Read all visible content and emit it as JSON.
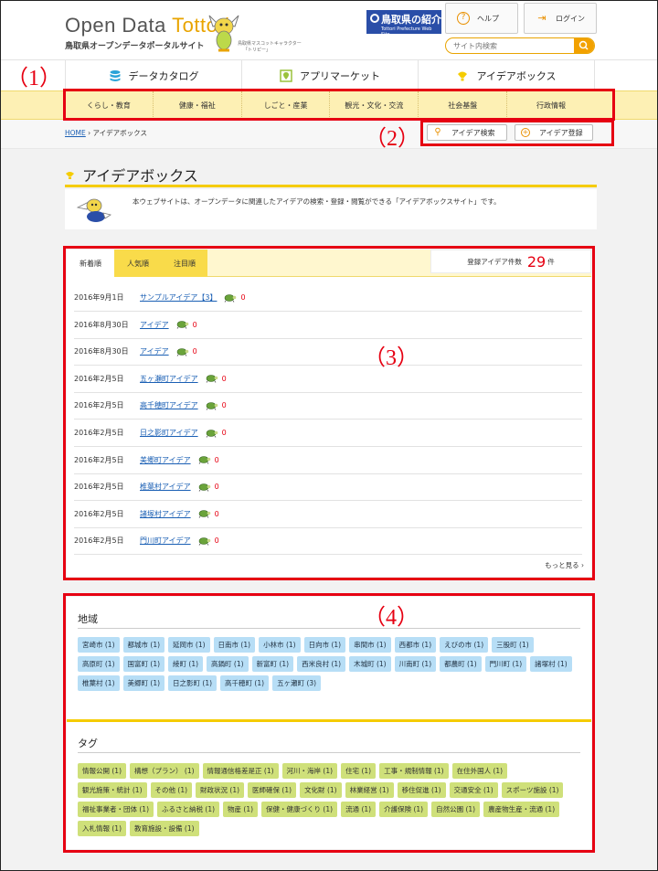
{
  "header": {
    "logo_text_a": "Open Data ",
    "logo_text_b": "Tottori",
    "logo_sub": "鳥取県オープンデータポータルサイト",
    "mascot_caption_1": "鳥取県マスコットキャラクター",
    "mascot_caption_2": "「トリピー」",
    "pref_link_jp": "鳥取県の紹介",
    "pref_link_en": "Tottori Prefecture Web Site",
    "help_label": "ヘルプ",
    "login_label": "ログイン",
    "search_placeholder": "サイト内検索"
  },
  "mainnav": {
    "items": [
      {
        "label": "データカタログ",
        "icon": "database-icon"
      },
      {
        "label": "アプリマーケット",
        "icon": "map-pin-icon"
      },
      {
        "label": "アイデアボックス",
        "icon": "lightbulb-icon"
      }
    ]
  },
  "categories": [
    "くらし・教育",
    "健康・福祉",
    "しごと・産業",
    "観光・文化・交流",
    "社会基盤",
    "行政情報"
  ],
  "breadcrumb": {
    "home": "HOME",
    "sep": " › ",
    "current": "アイデアボックス"
  },
  "actions": {
    "search_label": "アイデア検索",
    "register_label": "アイデア登録"
  },
  "annotations": {
    "one": "（1）",
    "two": "（2）",
    "three": "（3）",
    "four": "（4）"
  },
  "page": {
    "title": "アイデアボックス",
    "intro": "本ウェブサイトは、オープンデータに関連したアイデアの検索・登録・閲覧ができる「アイデアボックスサイト」です。"
  },
  "ideas": {
    "tabs": [
      "新着順",
      "人気順",
      "注目順"
    ],
    "count_label": "登録アイデア件数",
    "count": "29",
    "count_unit": "件",
    "more": "もっと見る ›",
    "rows": [
      {
        "date": "2016年9月1日",
        "title": "サンプルアイデア【3】",
        "likes": "0"
      },
      {
        "date": "2016年8月30日",
        "title": "アイデア",
        "likes": "0"
      },
      {
        "date": "2016年8月30日",
        "title": "アイデア",
        "likes": "0"
      },
      {
        "date": "2016年2月5日",
        "title": "五ヶ瀬町アイデア",
        "likes": "0"
      },
      {
        "date": "2016年2月5日",
        "title": "高千穂町アイデア",
        "likes": "0"
      },
      {
        "date": "2016年2月5日",
        "title": "日之影町アイデア",
        "likes": "0"
      },
      {
        "date": "2016年2月5日",
        "title": "美郷町アイデア",
        "likes": "0"
      },
      {
        "date": "2016年2月5日",
        "title": "椎葉村アイデア",
        "likes": "0"
      },
      {
        "date": "2016年2月5日",
        "title": "諸塚村アイデア",
        "likes": "0"
      },
      {
        "date": "2016年2月5日",
        "title": "門川町アイデア",
        "likes": "0"
      }
    ]
  },
  "filters": {
    "region_title": "地域",
    "regions": [
      "宮崎市 (1)",
      "都城市 (1)",
      "延岡市 (1)",
      "日南市 (1)",
      "小林市 (1)",
      "日向市 (1)",
      "串間市 (1)",
      "西都市 (1)",
      "えびの市 (1)",
      "三股町 (1)",
      "高原町 (1)",
      "国富町 (1)",
      "綾町 (1)",
      "高鍋町 (1)",
      "新富町 (1)",
      "西米良村 (1)",
      "木城町 (1)",
      "川南町 (1)",
      "都農町 (1)",
      "門川町 (1)",
      "諸塚村 (1)",
      "椎葉村 (1)",
      "美郷町 (1)",
      "日之影町 (1)",
      "高千穂町 (1)",
      "五ヶ瀬町 (3)"
    ],
    "tag_title": "タグ",
    "tags": [
      "情報公開 (1)",
      "構想（プラン） (1)",
      "情報通信格差是正 (1)",
      "河川・海岸 (1)",
      "住宅 (1)",
      "工事・規制情報 (1)",
      "在住外国人 (1)",
      "観光施策・統計 (1)",
      "その他 (1)",
      "財政状況 (1)",
      "医師確保 (1)",
      "文化財 (1)",
      "林業経営 (1)",
      "移住促進 (1)",
      "交通安全 (1)",
      "スポーツ施設 (1)",
      "福祉事業者・団体 (1)",
      "ふるさと納税 (1)",
      "物産 (1)",
      "保健・健康づくり (1)",
      "流通 (1)",
      "介護保険 (1)",
      "自然公園 (1)",
      "農産物生産・流通 (1)",
      "入札情報 (1)",
      "教育施設・設備 (1)"
    ]
  },
  "colors": {
    "accent": "#f5cc00",
    "annotation": "#e60012",
    "link": "#1a5fb4",
    "region_chip": "#b7def6",
    "tag_chip": "#cfe07a"
  }
}
